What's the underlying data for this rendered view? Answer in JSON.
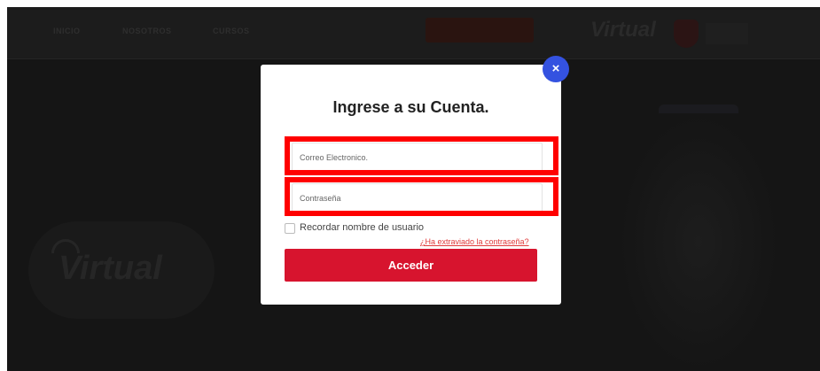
{
  "nav": {
    "links": [
      "INICIO",
      "NOSOTROS",
      "CURSOS",
      "INGRESAR"
    ]
  },
  "brand": {
    "logo_text": "Virtual"
  },
  "hero": {
    "logo_text": "Virtual"
  },
  "modal": {
    "title": "Ingrese a su Cuenta.",
    "close_label": "×",
    "email_placeholder": "Correo Electronico.",
    "password_placeholder": "Contraseña",
    "remember_label": "Recordar nombre de usuario",
    "forgot_label": "¿Ha extraviado la contraseña?",
    "submit_label": "Acceder"
  },
  "colors": {
    "accent": "#d7142e",
    "close_button": "#3452e0",
    "highlight": "#ff0000",
    "link": "#e03a3a"
  }
}
